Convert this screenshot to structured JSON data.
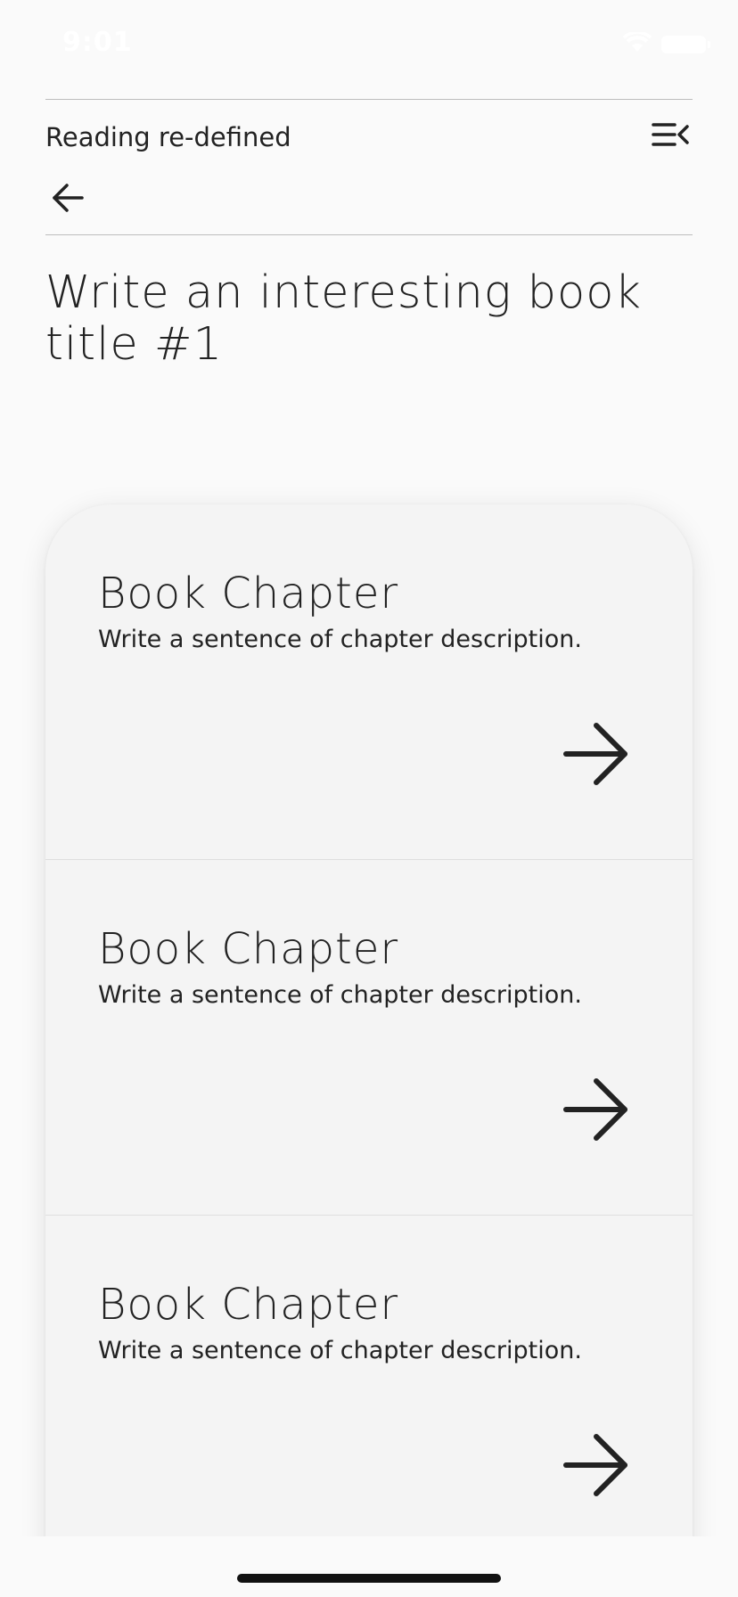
{
  "status_bar": {
    "time": "9:01"
  },
  "header": {
    "app_title": "Reading re-defined",
    "menu_icon": "menu-collapse-icon",
    "back_icon": "arrow-left-icon"
  },
  "book": {
    "title": "Write an interesting book title #1"
  },
  "chapters": [
    {
      "title": "Book Chapter",
      "description": "Write a sentence of chapter description.",
      "icon": "arrow-right-icon"
    },
    {
      "title": "Book Chapter",
      "description": "Write a sentence of chapter description.",
      "icon": "arrow-right-icon"
    },
    {
      "title": "Book Chapter",
      "description": "Write a sentence of chapter description.",
      "icon": "arrow-right-icon"
    }
  ],
  "colors": {
    "background": "#fafafa",
    "card": "#f4f4f4",
    "text": "#222222",
    "divider": "#bdbdbd"
  }
}
